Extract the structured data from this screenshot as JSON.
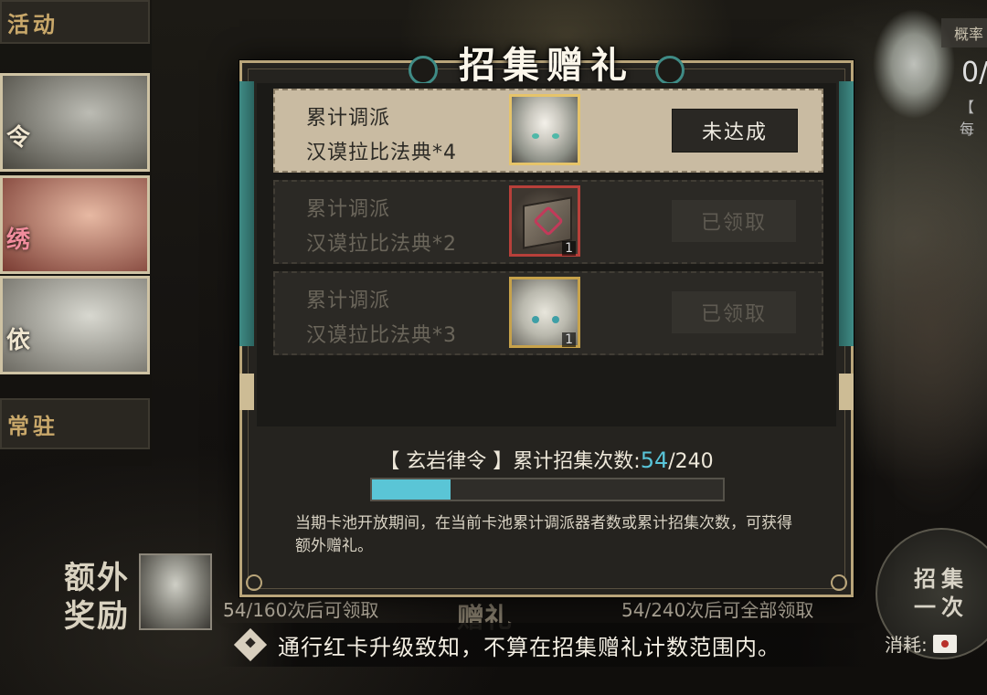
{
  "background": {
    "left_tabs": [
      "活动",
      "常驻"
    ],
    "left_cards": [
      "令",
      "绣",
      "依"
    ],
    "rate_tab": "概率",
    "right_number": "0/",
    "right_sub": "【 每",
    "extra_label": [
      "额外",
      "奖励"
    ],
    "bg_progress_left": "54/160次后可领取",
    "bg_word": "赠礼",
    "bg_progress_right": "54/240次后可全部领取",
    "draw_button": [
      "招集",
      "一次"
    ],
    "consume_label": "消耗:"
  },
  "modal": {
    "title": "招集赠礼",
    "rows": [
      {
        "line1": "累计调派",
        "line2": "汉谟拉比法典*4",
        "reward_count": "",
        "button": "未达成",
        "state": "unachieved",
        "reward_icon": "character-portrait-icon"
      },
      {
        "line1": "累计调派",
        "line2": "汉谟拉比法典*2",
        "reward_count": "1",
        "button": "已领取",
        "state": "claimed",
        "reward_icon": "book-box-icon"
      },
      {
        "line1": "累计调派",
        "line2": "汉谟拉比法典*3",
        "reward_count": "1",
        "button": "已领取",
        "state": "claimed",
        "reward_icon": "chibi-character-icon"
      }
    ],
    "progress": {
      "prefix": "【 玄岩律令 】累计招集次数:",
      "current": "54",
      "total": "/240",
      "fraction": 0.225
    },
    "description": "当期卡池开放期间，在当前卡池累计调派器者数或累计招集次数，可获得额外赠礼。"
  },
  "notice": "通行红卡升级致知，不算在招集赠礼计数范围内。",
  "colors": {
    "accent_teal": "#3f8b85",
    "progress_fill": "#5ac5d6",
    "gold_border": "#b9a57a"
  }
}
